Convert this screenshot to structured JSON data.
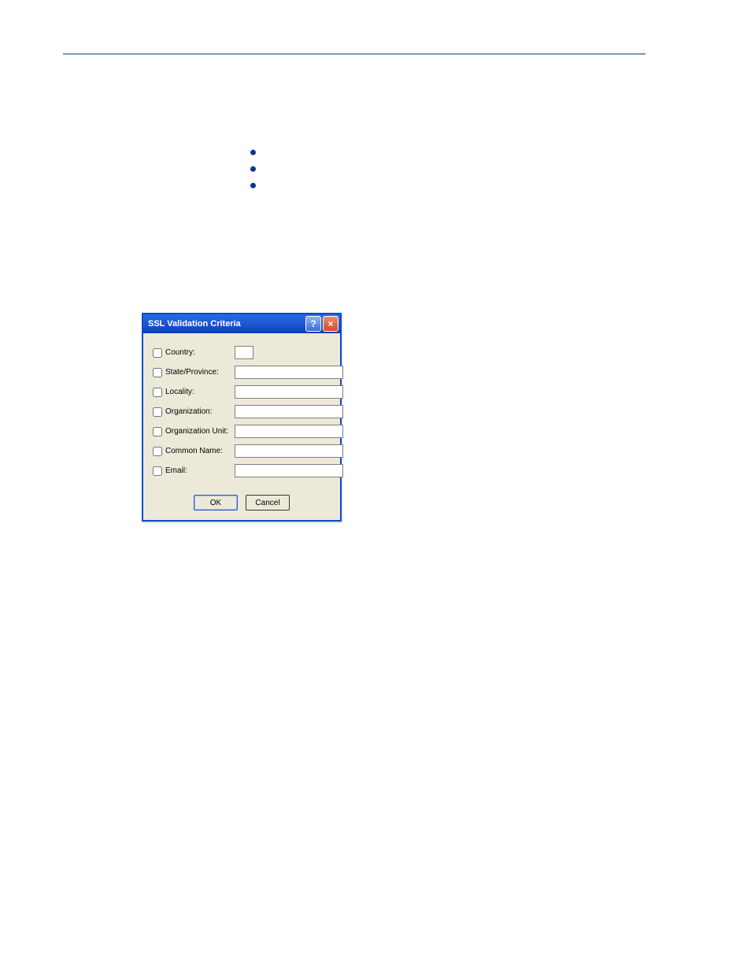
{
  "dialog": {
    "title": "SSL Validation Criteria",
    "help_glyph": "?",
    "close_glyph": "×",
    "labels": {
      "country": "Country:",
      "state": "State/Province:",
      "locality": "Locality:",
      "organization": "Organization:",
      "org_unit": "Organization Unit:",
      "common_name": "Common Name:",
      "email": "Email:"
    },
    "values": {
      "country": "",
      "state": "",
      "locality": "",
      "organization": "",
      "org_unit": "",
      "common_name": "",
      "email": ""
    },
    "buttons": {
      "ok": "OK",
      "cancel": "Cancel"
    }
  }
}
